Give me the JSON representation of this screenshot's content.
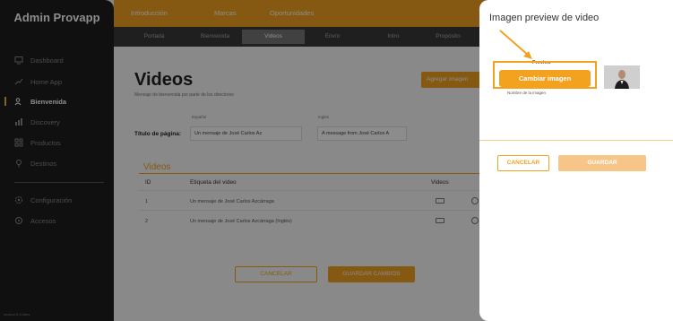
{
  "sidebar": {
    "brand": "Admin Provapp",
    "items": [
      {
        "label": "Dashboard",
        "icon": "monitor-icon"
      },
      {
        "label": "Home App",
        "icon": "chart-icon"
      },
      {
        "label": "Bienvenida",
        "icon": "users-icon"
      },
      {
        "label": "Discovery",
        "icon": "bars-icon"
      },
      {
        "label": "Productos",
        "icon": "grid-icon"
      },
      {
        "label": "Destinos",
        "icon": "pin-icon"
      }
    ],
    "bottom_items": [
      {
        "label": "Configuración",
        "icon": "gear-icon"
      },
      {
        "label": "Accesos",
        "icon": "key-icon"
      }
    ],
    "version": "version 0.0.0dev"
  },
  "topnav": [
    "Introducción",
    "Marcas",
    "Oportunidades"
  ],
  "subnav": [
    "Portada",
    "Bienvenida",
    "Videos",
    "Envío",
    "Intro",
    "Propósito"
  ],
  "page": {
    "title": "Videos",
    "subtitle": "Mensaje de bienvenida por parte de los directores",
    "add_button": "Agregar imagen",
    "title_label": "Título de página:",
    "spanish_label": "Español",
    "english_label": "Inglés",
    "title_es": "Un mensaje de José Carlos Az",
    "title_en": "A message from José Carlos A",
    "section": "Videos",
    "headers": [
      "ID",
      "Etiqueta del video",
      "Videos"
    ],
    "rows": [
      {
        "id": "1",
        "label": "Un mensaje de José Carlos Azcárraga"
      },
      {
        "id": "2",
        "label": "Un mensaje de José Carlos Azcárraga (Inglés)"
      }
    ],
    "cancel": "CANCELAR",
    "save": "GUARDAR CAMBIOS"
  },
  "modal": {
    "title": "Imagen preview de video",
    "preview_label": "Preview",
    "change_button": "Cambiar imagen",
    "image_name_label": "Nombre de la imagen",
    "cancel": "CANCELAR",
    "save": "GUARDAR"
  },
  "colors": {
    "accent": "#f3a21f",
    "sidebar": "#1e1e1e"
  }
}
